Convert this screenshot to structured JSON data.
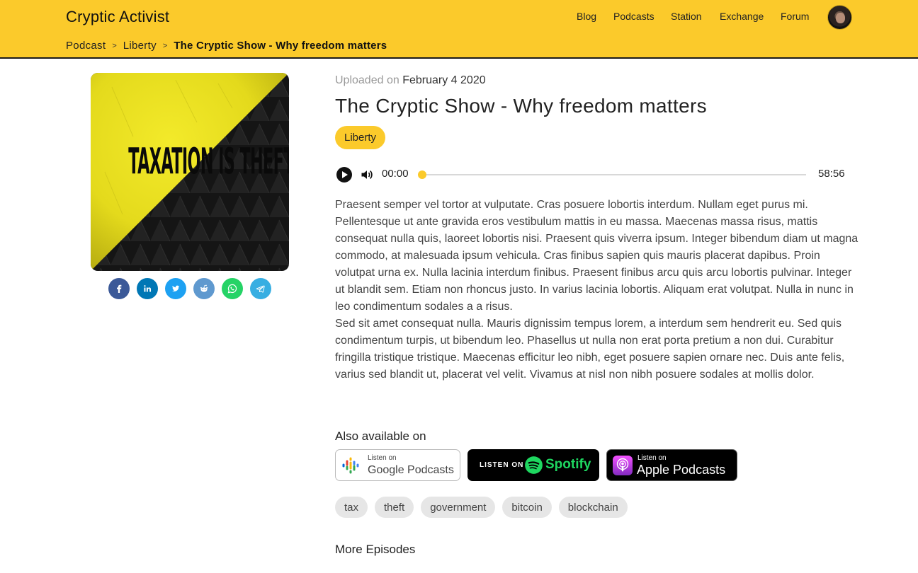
{
  "header": {
    "brand": "Cryptic Activist",
    "nav": [
      {
        "label": "Blog"
      },
      {
        "label": "Podcasts"
      },
      {
        "label": "Station"
      },
      {
        "label": "Exchange"
      },
      {
        "label": "Forum"
      }
    ],
    "breadcrumb": {
      "items": [
        "Podcast",
        "Liberty"
      ],
      "separator": ">",
      "current": "The Cryptic Show - Why freedom matters"
    }
  },
  "colors": {
    "accent": "#fbca2b",
    "text": "#333333"
  },
  "cover": {
    "text": "TAXATION IS THEFT",
    "icon": "cover-art-image"
  },
  "share": [
    {
      "network": "facebook",
      "icon": "facebook-icon",
      "color": "#3b5998"
    },
    {
      "network": "linkedin",
      "icon": "linkedin-icon",
      "color": "#0077b5"
    },
    {
      "network": "twitter",
      "icon": "twitter-icon",
      "color": "#1da1f2"
    },
    {
      "network": "reddit",
      "icon": "reddit-icon",
      "color": "#5f99cf"
    },
    {
      "network": "whatsapp",
      "icon": "whatsapp-icon",
      "color": "#25d366"
    },
    {
      "network": "telegram",
      "icon": "telegram-icon",
      "color": "#37aee2"
    }
  ],
  "episode": {
    "uploaded_label": "Uploaded on",
    "uploaded_date": "February 4 2020",
    "title": "The Cryptic Show - Why freedom matters",
    "category": "Liberty",
    "player": {
      "current_time": "00:00",
      "duration": "58:56",
      "progress": 0
    },
    "description": [
      "Praesent semper vel tortor at vulputate. Cras posuere lobortis interdum. Nullam eget purus mi. Pellentesque ut ante gravida eros vestibulum mattis in eu massa. Maecenas massa risus, mattis consequat nulla quis, laoreet lobortis nisi. Praesent quis viverra ipsum. Integer bibendum diam ut magna commodo, at malesuada ipsum vehicula. Cras finibus sapien quis mauris placerat dapibus. Proin volutpat urna ex. Nulla lacinia interdum finibus. Praesent finibus arcu quis arcu lobortis pulvinar. Integer ut blandit sem. Etiam non rhoncus justo. In varius lacinia lobortis. Aliquam erat volutpat. Nulla in nunc in leo condimentum sodales a a risus.",
      "Sed sit amet consequat nulla. Mauris dignissim tempus lorem, a interdum sem hendrerit eu. Sed quis condimentum turpis, ut bibendum leo. Phasellus ut nulla non erat porta pretium a non dui. Curabitur fringilla tristique tristique. Maecenas efficitur leo nibh, eget posuere sapien ornare nec. Duis ante felis, varius sed blandit ut, placerat vel velit. Vivamus at nisl non nibh posuere sodales at mollis dolor."
    ]
  },
  "also_available": {
    "heading": "Also available on",
    "platforms": [
      {
        "small": "Listen on",
        "big": "Google Podcasts",
        "icon": "google-podcasts-icon"
      },
      {
        "small": "LISTEN ON",
        "big": "Spotify",
        "icon": "spotify-icon"
      },
      {
        "small": "Listen on",
        "big": "Apple Podcasts",
        "icon": "apple-podcasts-icon"
      }
    ]
  },
  "tags": [
    "tax",
    "theft",
    "government",
    "bitcoin",
    "blockchain"
  ],
  "more_episodes": "More Episodes"
}
